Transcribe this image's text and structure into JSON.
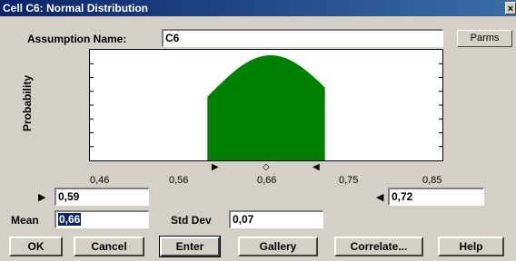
{
  "window": {
    "title": "Cell C6: Normal Distribution",
    "close_glyph": "×"
  },
  "assumption": {
    "label": "Assumption Name:",
    "value": "C6",
    "parms_label": "Parms"
  },
  "chart": {
    "y_label": "Probability",
    "x_ticks": [
      "0,46",
      "0,56",
      "0,66",
      "0,75",
      "0,85"
    ],
    "fill_color": "#008000"
  },
  "chart_data": {
    "type": "area",
    "distribution": "normal",
    "mean": 0.66,
    "std_dev": 0.07,
    "xlim": [
      0.46,
      0.85
    ],
    "shaded_range": [
      0.59,
      0.72
    ],
    "ylabel": "Probability",
    "x_tick_labels": [
      "0,46",
      "0,56",
      "0,66",
      "0,75",
      "0,85"
    ],
    "color": "#008000"
  },
  "range": {
    "lower": "0,59",
    "upper": "0,72"
  },
  "params": {
    "mean_label": "Mean",
    "mean_value": "0,66",
    "std_label": "Std Dev",
    "std_value": "0,07"
  },
  "buttons": {
    "ok": "OK",
    "cancel": "Cancel",
    "enter": "Enter",
    "gallery": "Gallery",
    "correlate": "Correlate...",
    "help": "Help"
  }
}
